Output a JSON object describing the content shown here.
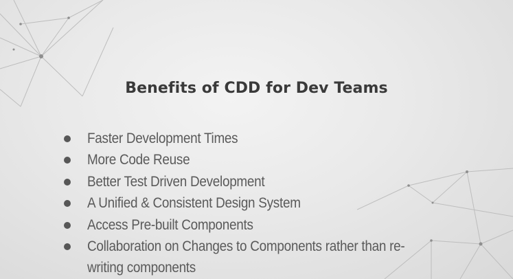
{
  "slide": {
    "title": "Benefits of CDD for Dev Teams",
    "bullets": [
      "Faster Development Times",
      "More Code Reuse",
      "Better Test Driven Development",
      "A Unified & Consistent Design System",
      "Access Pre-built Components",
      "Collaboration on Changes to Components rather than re-writing components"
    ]
  },
  "colors": {
    "title": "#3a3a3a",
    "text": "#5a5a5a",
    "bullet": "#575757",
    "decor_line": "#b8b8b8",
    "decor_node": "#8e8e8e"
  },
  "icons": [
    "network-lines-decoration",
    "bullet-dot-icon"
  ]
}
